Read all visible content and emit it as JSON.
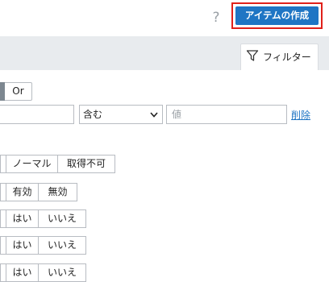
{
  "header": {
    "help_icon": "question-icon",
    "help_symbol": "?",
    "create_button": "アイテムの作成",
    "accent_color": "#1f75c4",
    "highlight_color": "#e0201a"
  },
  "filter_tab": {
    "icon": "filter-icon",
    "label": "フィルター"
  },
  "filter_row": {
    "logic_option": "Or",
    "operator": "含む",
    "value_placeholder": "値",
    "delete_label": "削除"
  },
  "toggle_groups": [
    {
      "options": [
        "ノーマル",
        "取得不可"
      ]
    },
    {
      "options": [
        "有効",
        "無効"
      ]
    },
    {
      "options": [
        "はい",
        "いいえ"
      ]
    },
    {
      "options": [
        "はい",
        "いいえ"
      ]
    },
    {
      "options": [
        "はい",
        "いいえ"
      ]
    }
  ]
}
